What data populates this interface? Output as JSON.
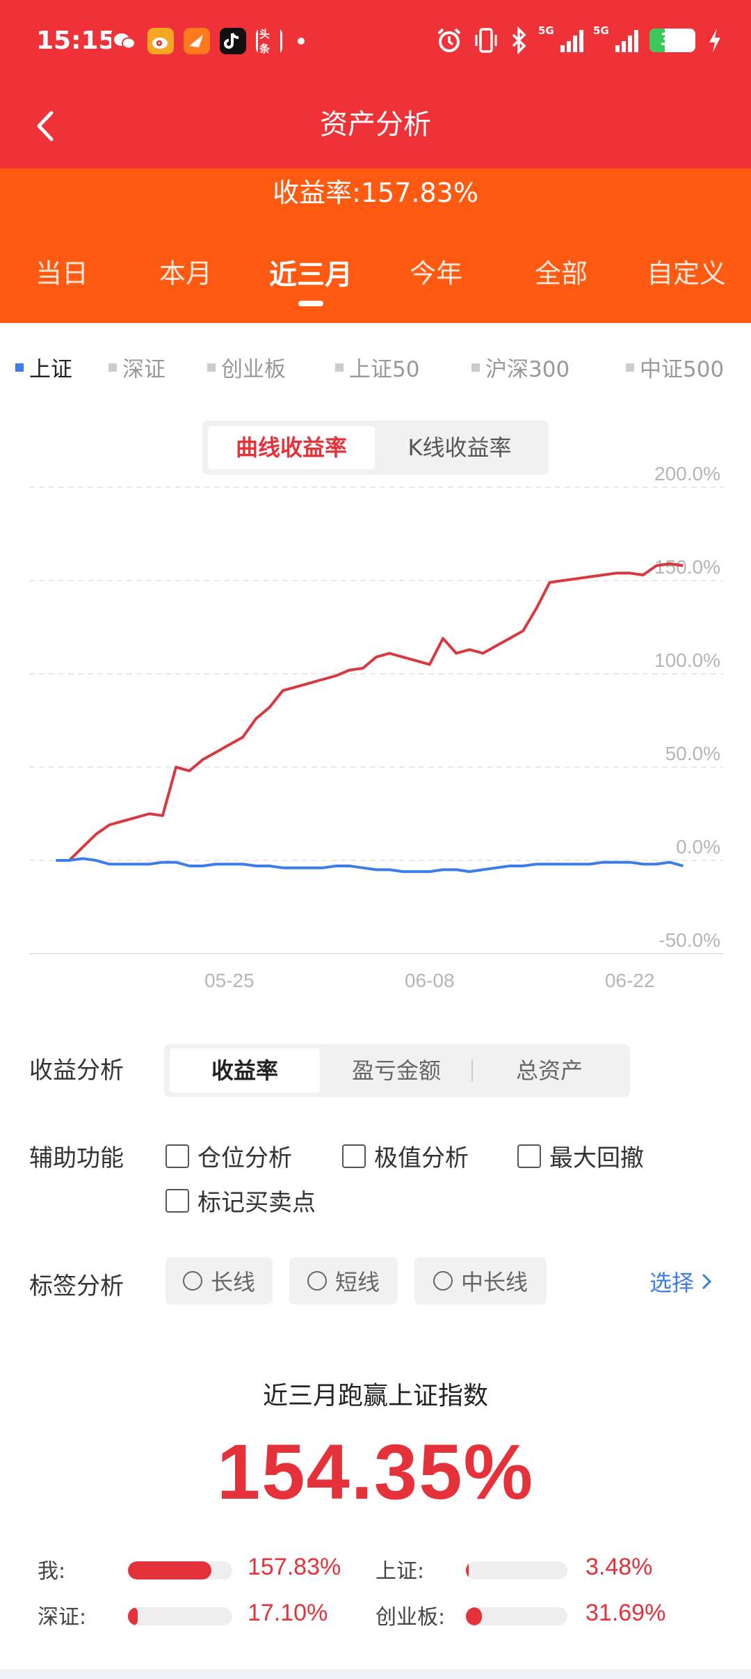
{
  "status_bar": {
    "time": "15:15",
    "apps": [
      {
        "name": "wechat-app-icon",
        "label": "",
        "color": "#ee3238"
      },
      {
        "name": "weibo-app-icon",
        "label": "",
        "color": "#f5a623"
      },
      {
        "name": "feishu-app-icon",
        "label": "",
        "color": "#ff7a1a"
      },
      {
        "name": "douyin-app-icon",
        "label": "",
        "color": "#111111"
      },
      {
        "name": "toutiao-app-icon",
        "label": "头条",
        "color": "#ee3238"
      }
    ],
    "network_1": "5G",
    "network_2": "5G",
    "battery": "34",
    "battery_level": 0.34
  },
  "nav": {
    "title": "资产分析"
  },
  "header": {
    "return_rate": "收益率:157.83%",
    "periods": [
      "当日",
      "本月",
      "近三月",
      "今年",
      "全部",
      "自定义"
    ],
    "active_period": 2
  },
  "index_legend": {
    "items": [
      "上证",
      "深证",
      "创业板",
      "上证50",
      "沪深300",
      "中证500"
    ],
    "active": 0
  },
  "chart_toggle": {
    "options": [
      "曲线收益率",
      "K线收益率"
    ],
    "active": 0
  },
  "chart_data": {
    "type": "line",
    "y_ticks": [
      "200.0%",
      "150.0%",
      "100.0%",
      "50.0%",
      "0.0%",
      "-50.0%"
    ],
    "x_ticks": [
      {
        "label": "05-25",
        "x": 13
      },
      {
        "label": "06-08",
        "x": 28
      },
      {
        "label": "06-22",
        "x": 43
      }
    ],
    "ylim": [
      -50,
      200
    ],
    "xlim": [
      -2,
      50
    ],
    "grid": true,
    "series": [
      {
        "color": "#d63a40",
        "points": [
          [
            0,
            0
          ],
          [
            1,
            0
          ],
          [
            2,
            7
          ],
          [
            3,
            14
          ],
          [
            4,
            19
          ],
          [
            5,
            21
          ],
          [
            6,
            23
          ],
          [
            7,
            25
          ],
          [
            8,
            24
          ],
          [
            9,
            50
          ],
          [
            10,
            48
          ],
          [
            11,
            54
          ],
          [
            12,
            58
          ],
          [
            13,
            62
          ],
          [
            14,
            66
          ],
          [
            15,
            76
          ],
          [
            16,
            82
          ],
          [
            17,
            91
          ],
          [
            18,
            93
          ],
          [
            19,
            95
          ],
          [
            20,
            97
          ],
          [
            21,
            99
          ],
          [
            22,
            102
          ],
          [
            23,
            103
          ],
          [
            24,
            109
          ],
          [
            25,
            111
          ],
          [
            26,
            109
          ],
          [
            27,
            107
          ],
          [
            28,
            105
          ],
          [
            29,
            119
          ],
          [
            30,
            111
          ],
          [
            31,
            113
          ],
          [
            32,
            111
          ],
          [
            33,
            115
          ],
          [
            34,
            119
          ],
          [
            35,
            123
          ],
          [
            36,
            135
          ],
          [
            37,
            149
          ],
          [
            38,
            150
          ],
          [
            39,
            151
          ],
          [
            40,
            152
          ],
          [
            41,
            153
          ],
          [
            42,
            154
          ],
          [
            43,
            154
          ],
          [
            44,
            153
          ],
          [
            45,
            158
          ],
          [
            46,
            159
          ],
          [
            47,
            158
          ]
        ]
      },
      {
        "color": "#3d7ee6",
        "points": [
          [
            0,
            0
          ],
          [
            1,
            0
          ],
          [
            2,
            1
          ],
          [
            3,
            0
          ],
          [
            4,
            -2
          ],
          [
            5,
            -2
          ],
          [
            6,
            -2
          ],
          [
            7,
            -2
          ],
          [
            8,
            -1
          ],
          [
            9,
            -1
          ],
          [
            10,
            -3
          ],
          [
            11,
            -3
          ],
          [
            12,
            -2
          ],
          [
            13,
            -2
          ],
          [
            14,
            -2
          ],
          [
            15,
            -3
          ],
          [
            16,
            -3
          ],
          [
            17,
            -4
          ],
          [
            18,
            -4
          ],
          [
            19,
            -4
          ],
          [
            20,
            -4
          ],
          [
            21,
            -3
          ],
          [
            22,
            -3
          ],
          [
            23,
            -4
          ],
          [
            24,
            -5
          ],
          [
            25,
            -5
          ],
          [
            26,
            -6
          ],
          [
            27,
            -6
          ],
          [
            28,
            -6
          ],
          [
            29,
            -5
          ],
          [
            30,
            -5
          ],
          [
            31,
            -6
          ],
          [
            32,
            -5
          ],
          [
            33,
            -4
          ],
          [
            34,
            -3
          ],
          [
            35,
            -3
          ],
          [
            36,
            -2
          ],
          [
            37,
            -2
          ],
          [
            38,
            -2
          ],
          [
            39,
            -2
          ],
          [
            40,
            -2
          ],
          [
            41,
            -1
          ],
          [
            42,
            -1
          ],
          [
            43,
            -1
          ],
          [
            44,
            -2
          ],
          [
            45,
            -2
          ],
          [
            46,
            -1
          ],
          [
            47,
            -3
          ]
        ]
      }
    ]
  },
  "analysis": {
    "label": "收益分析",
    "options": [
      "收益率",
      "盈亏金额",
      "总资产"
    ],
    "active": 0
  },
  "aux": {
    "label": "辅助功能",
    "options": [
      "仓位分析",
      "极值分析",
      "最大回撤",
      "标记买卖点"
    ]
  },
  "tags": {
    "label": "标签分析",
    "options": [
      "长线",
      "短线",
      "中长线"
    ],
    "select": "选择"
  },
  "beat": {
    "title": "近三月跑赢上证指数",
    "value": "154.35%"
  },
  "comparisons": [
    {
      "label": "我:",
      "value": "157.83%",
      "fill": 0.8
    },
    {
      "label": "上证:",
      "value": "3.48%",
      "fill": 0.02
    },
    {
      "label": "深证:",
      "value": "17.10%",
      "fill": 0.09
    },
    {
      "label": "创业板:",
      "value": "31.69%",
      "fill": 0.16
    }
  ]
}
